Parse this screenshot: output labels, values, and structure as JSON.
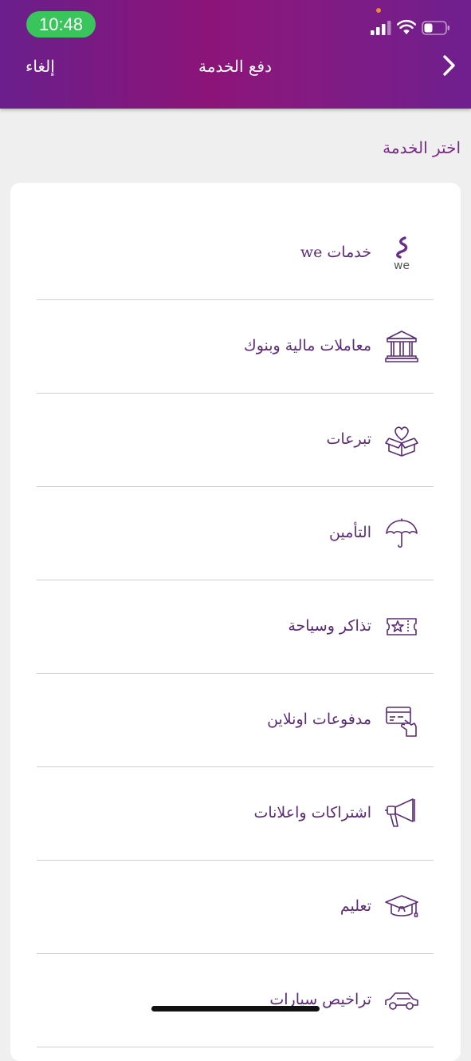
{
  "status_bar": {
    "time": "10:48",
    "time_pill_color": "#3ac55c"
  },
  "header": {
    "cancel_label": "إلغاء",
    "title": "دفع الخدمة",
    "back_icon": "chevron-right-icon",
    "gradient_colors": [
      "#6a1f8c",
      "#8c1478",
      "#6f1f8e"
    ]
  },
  "section_label": "اختر الخدمة",
  "services": [
    {
      "label": "خدمات we",
      "icon": "we-logo-icon"
    },
    {
      "label": "معاملات مالية وبنوك",
      "icon": "bank-icon"
    },
    {
      "label": "تبرعات",
      "icon": "donation-box-icon"
    },
    {
      "label": "التأمين",
      "icon": "umbrella-icon"
    },
    {
      "label": "تذاكر وسياحة",
      "icon": "ticket-icon"
    },
    {
      "label": "مدفوعات اونلاين",
      "icon": "card-payment-icon"
    },
    {
      "label": "اشتراكات واعلانات",
      "icon": "megaphone-icon"
    },
    {
      "label": "تعليم",
      "icon": "graduation-cap-icon"
    },
    {
      "label": "تراخيص سيارات",
      "icon": "car-icon"
    }
  ],
  "colors": {
    "accent": "#7a2a86",
    "label": "#5d2a78",
    "divider": "#cfcfcf",
    "background": "#efefef",
    "card": "#ffffff"
  }
}
